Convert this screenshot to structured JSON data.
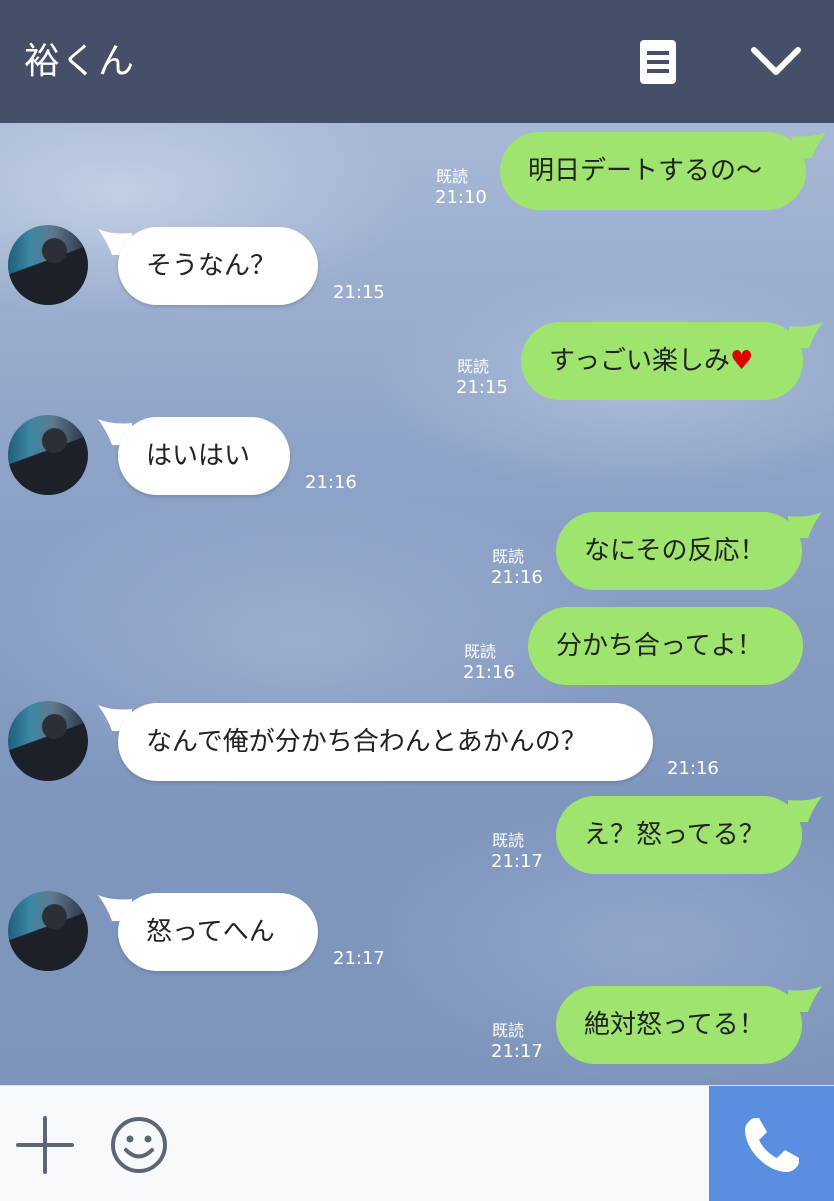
{
  "header": {
    "title": "裕くん",
    "menu_icon": "menu-icon",
    "collapse_icon": "chevron-down-icon",
    "background": "#454f68"
  },
  "colors": {
    "sent_bubble": "#9fe46f",
    "received_bubble": "#ffffff",
    "call_button": "#5a8ee0"
  },
  "messages": [
    {
      "side": "sent",
      "text": "明日デートするの〜",
      "read": "既読",
      "time": "21:10"
    },
    {
      "side": "received",
      "text": "そうなん？",
      "time": "21:15"
    },
    {
      "side": "sent",
      "text": "すっごい楽しみ",
      "emoji": "♥",
      "read": "既読",
      "time": "21:15"
    },
    {
      "side": "received",
      "text": "はいはい",
      "time": "21:16"
    },
    {
      "side": "sent",
      "text": "なにその反応！",
      "read": "既読",
      "time": "21:16"
    },
    {
      "side": "sent",
      "text": "分かち合ってよ！",
      "read": "既読",
      "time": "21:16"
    },
    {
      "side": "received",
      "text": "なんで俺が分かち合わんとあかんの？",
      "time": "21:16"
    },
    {
      "side": "sent",
      "text": "え？怒ってる？",
      "read": "既読",
      "time": "21:17"
    },
    {
      "side": "received",
      "text": "怒ってへん",
      "time": "21:17"
    },
    {
      "side": "sent",
      "text": "絶対怒ってる！",
      "read": "既読",
      "time": "21:17"
    }
  ],
  "footer": {
    "plus_icon": "plus-icon",
    "emoji_icon": "smiley-icon",
    "call_icon": "phone-icon"
  }
}
